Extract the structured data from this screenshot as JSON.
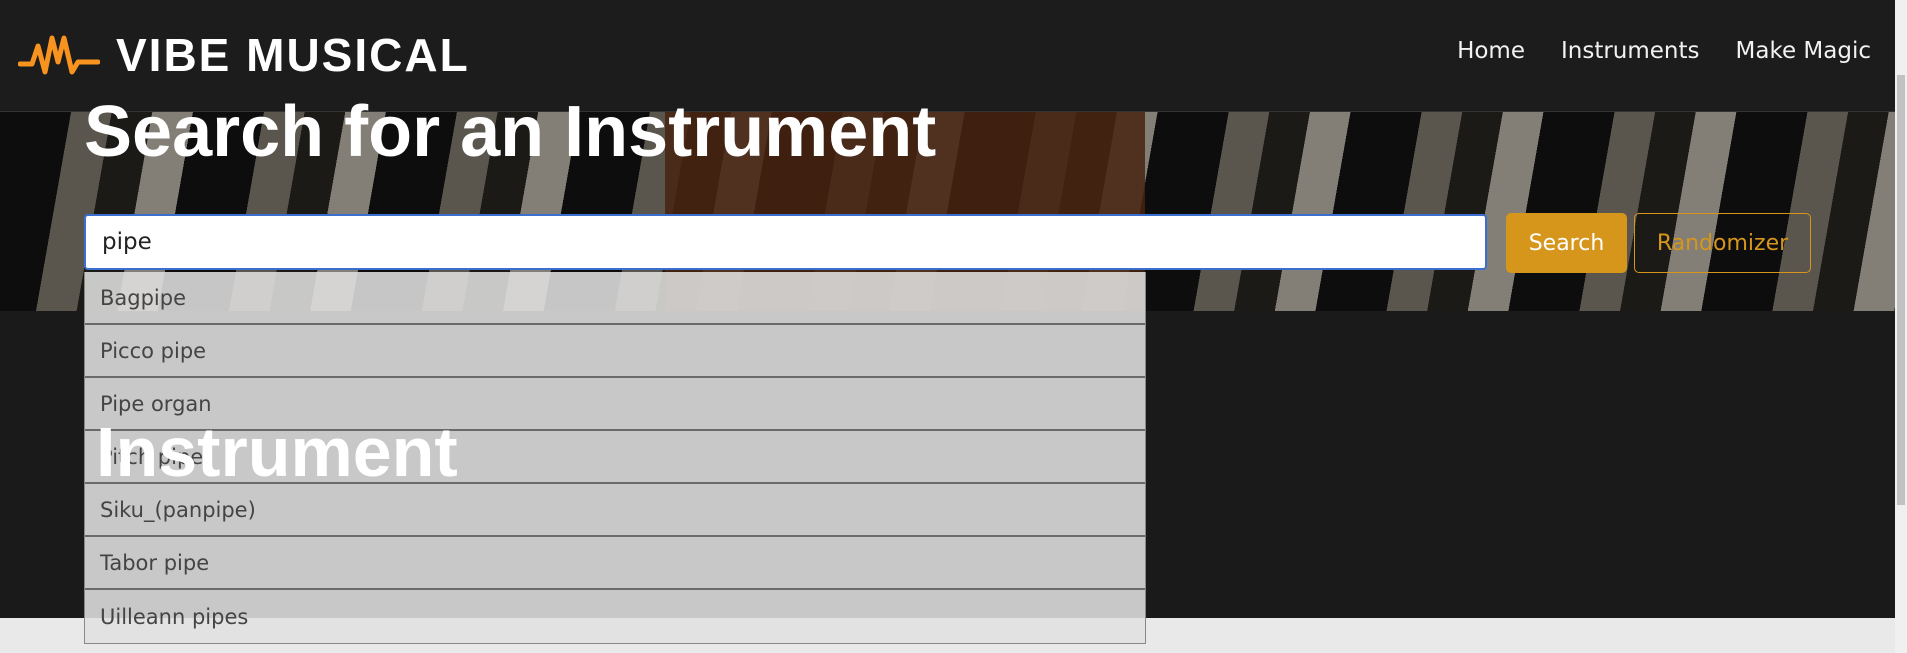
{
  "brand": {
    "name": "VIBE MUSICAL",
    "accent": "#f7931e"
  },
  "nav": {
    "links": [
      "Home",
      "Instruments",
      "Make Magic"
    ]
  },
  "hero": {
    "title": "Search for an Instrument"
  },
  "search": {
    "value": "pipe",
    "button": "Search",
    "randomizer": "Randomizer",
    "accent": "#d6961c"
  },
  "suggestions": [
    "Bagpipe",
    "Picco pipe",
    "Pipe organ",
    "Pitch pipe",
    "Siku_(panpipe)",
    "Tabor pipe",
    "Uilleann pipes"
  ],
  "section": {
    "heading": "Instrument"
  }
}
